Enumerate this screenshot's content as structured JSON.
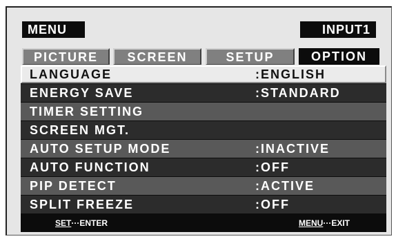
{
  "header": {
    "menu_label": "MENU",
    "input_label": "INPUT1"
  },
  "tabs": [
    {
      "label": "PICTURE",
      "active": false
    },
    {
      "label": "SCREEN",
      "active": false
    },
    {
      "label": "SETUP",
      "active": false
    },
    {
      "label": "OPTION",
      "active": true
    }
  ],
  "items": [
    {
      "label": "LANGUAGE",
      "value": ":ENGLISH",
      "selected": true
    },
    {
      "label": "ENERGY SAVE",
      "value": ":STANDARD"
    },
    {
      "label": "TIMER SETTING",
      "value": ""
    },
    {
      "label": "SCREEN MGT.",
      "value": ""
    },
    {
      "label": "AUTO SETUP MODE",
      "value": ":INACTIVE"
    },
    {
      "label": "AUTO FUNCTION",
      "value": ":OFF"
    },
    {
      "label": "PIP DETECT",
      "value": ":ACTIVE"
    },
    {
      "label": "SPLIT FREEZE",
      "value": ":OFF"
    }
  ],
  "footer": {
    "set_key": "SET",
    "set_action": "···ENTER",
    "menu_key": "MENU",
    "menu_action": "···EXIT"
  }
}
